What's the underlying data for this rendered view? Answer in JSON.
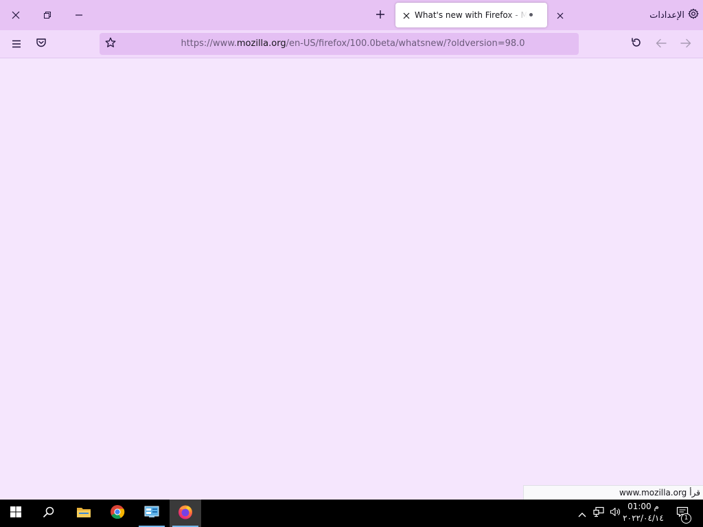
{
  "browser": {
    "tab": {
      "title": "What's new with Firefox - Mozilla"
    },
    "settings_label": "الإعدادات",
    "url": {
      "prefix": "https://www.",
      "domain": "mozilla.org",
      "path": "/en-US/firefox/100.0beta/whatsnew/?oldversion=98.0"
    },
    "status": {
      "label": "قرأ",
      "host": "www.mozilla.org"
    }
  },
  "taskbar": {
    "apps": [
      {
        "name": "start",
        "icon": "windows-logo-icon"
      },
      {
        "name": "search",
        "icon": "search-icon"
      },
      {
        "name": "file-explorer",
        "icon": "folder-icon"
      },
      {
        "name": "chrome",
        "icon": "chrome-icon"
      },
      {
        "name": "control-panel",
        "icon": "control-panel-icon"
      },
      {
        "name": "firefox",
        "icon": "firefox-icon",
        "active": true
      }
    ],
    "clock": {
      "time": "01:00 م",
      "date": "٢٠٢٢/٠٤/١٤"
    },
    "notification_count": "1"
  },
  "colors": {
    "titlebar": "#e7c3f4",
    "navbar": "#f1dafb",
    "urlbar": "#e4bff3",
    "content": "#f5e6fd",
    "taskbar": "#000000"
  }
}
